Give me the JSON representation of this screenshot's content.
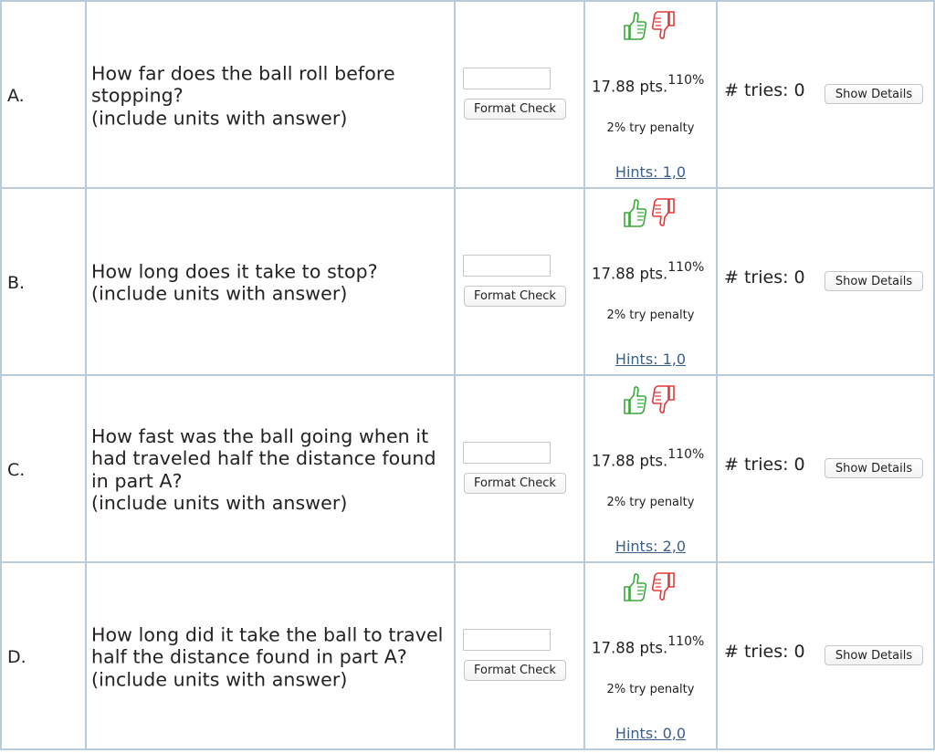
{
  "buttons": {
    "format_check": "Format Check",
    "show_details": "Show Details"
  },
  "icons": {
    "thumb_up": "thumbs-up-icon",
    "thumb_down": "thumbs-down-icon"
  },
  "colors": {
    "thumb_up": "#3ea63e",
    "thumb_down": "#e03838",
    "hints_link": "#3a5f8a",
    "grid_line": "#b9cbd8"
  },
  "rows": [
    {
      "letter": "A.",
      "question": [
        "How far does the ball roll before",
        "stopping?",
        "(include units with answer)"
      ],
      "answer_value": "",
      "points": "17.88 pts.",
      "percent": "110%",
      "penalty": "2% try penalty",
      "hints": "Hints: 1,0",
      "tries": "# tries: 0"
    },
    {
      "letter": "B.",
      "question": [
        "How long does it take to stop?",
        "(include units with answer)"
      ],
      "answer_value": "",
      "points": "17.88 pts.",
      "percent": "110%",
      "penalty": "2% try penalty",
      "hints": "Hints: 1,0",
      "tries": "# tries: 0"
    },
    {
      "letter": "C.",
      "question": [
        "How fast was the ball going when it",
        "had traveled half the distance found",
        "in part A?",
        "(include units with answer)"
      ],
      "answer_value": "",
      "points": "17.88 pts.",
      "percent": "110%",
      "penalty": "2% try penalty",
      "hints": "Hints: 2,0",
      "tries": "# tries: 0"
    },
    {
      "letter": "D.",
      "question": [
        "How long did it take the ball to travel",
        "half the distance found in part A?",
        "(include units with answer)"
      ],
      "answer_value": "",
      "points": "17.88 pts.",
      "percent": "110%",
      "penalty": "2% try penalty",
      "hints": "Hints: 0,0",
      "tries": "# tries: 0"
    }
  ]
}
